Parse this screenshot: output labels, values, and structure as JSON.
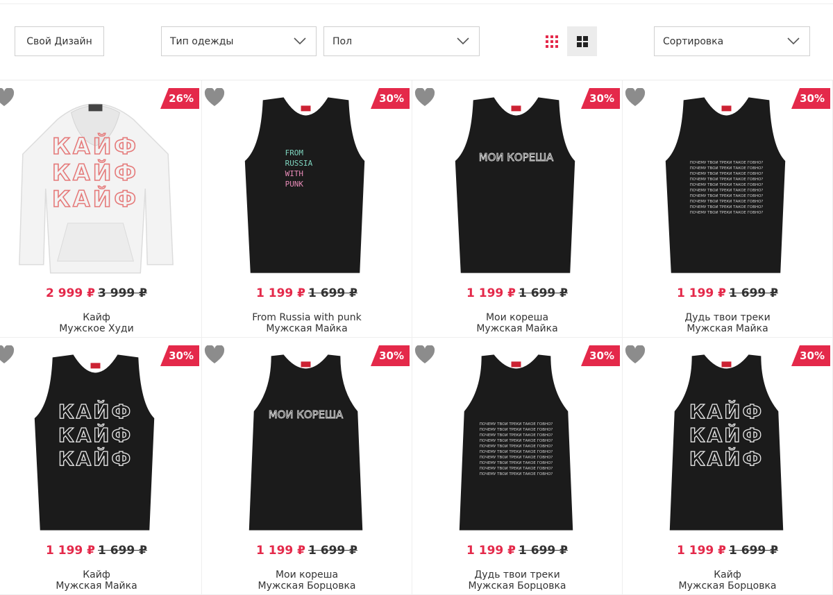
{
  "toolbar": {
    "design_button": "Свой Дизайн",
    "clothing_type": "Тип одежды",
    "gender": "Пол",
    "sort": "Сортировка"
  },
  "colors": {
    "accent": "#e4294a",
    "heart": "#8c8c8c"
  },
  "products": [
    {
      "name": "Кайф",
      "type": "Мужское Худи",
      "price": "2 999 ₽",
      "old_price": "3 999 ₽",
      "discount": "26%",
      "print": "Кайф\nКайф\nКайф"
    },
    {
      "name": "From Russia with punk",
      "type": "Мужская Майка",
      "price": "1 199 ₽",
      "old_price": "1 699 ₽",
      "discount": "30%",
      "print": "From\nRussia\nwith\npunk"
    },
    {
      "name": "Мои кореша",
      "type": "Мужская Майка",
      "price": "1 199 ₽",
      "old_price": "1 699 ₽",
      "discount": "30%",
      "print": "Мои кореша"
    },
    {
      "name": "Дудь твои треки",
      "type": "Мужская Майка",
      "price": "1 199 ₽",
      "old_price": "1 699 ₽",
      "discount": "30%",
      "print": "Почему твои треки такое говно?"
    },
    {
      "name": "Кайф",
      "type": "Мужская Майка",
      "price": "1 199 ₽",
      "old_price": "1 699 ₽",
      "discount": "30%",
      "print": "Кайф\nКайф\nКайф"
    },
    {
      "name": "Мои кореша",
      "type": "Мужская Борцовка",
      "price": "1 199 ₽",
      "old_price": "1 699 ₽",
      "discount": "30%",
      "print": "Мои кореша"
    },
    {
      "name": "Дудь твои треки",
      "type": "Мужская Борцовка",
      "price": "1 199 ₽",
      "old_price": "1 699 ₽",
      "discount": "30%",
      "print": "Почему твои треки такое говно?"
    },
    {
      "name": "Кайф",
      "type": "Мужская Борцовка",
      "price": "1 199 ₽",
      "old_price": "1 699 ₽",
      "discount": "30%",
      "print": "Кайф\nКайф\nКайф"
    }
  ]
}
